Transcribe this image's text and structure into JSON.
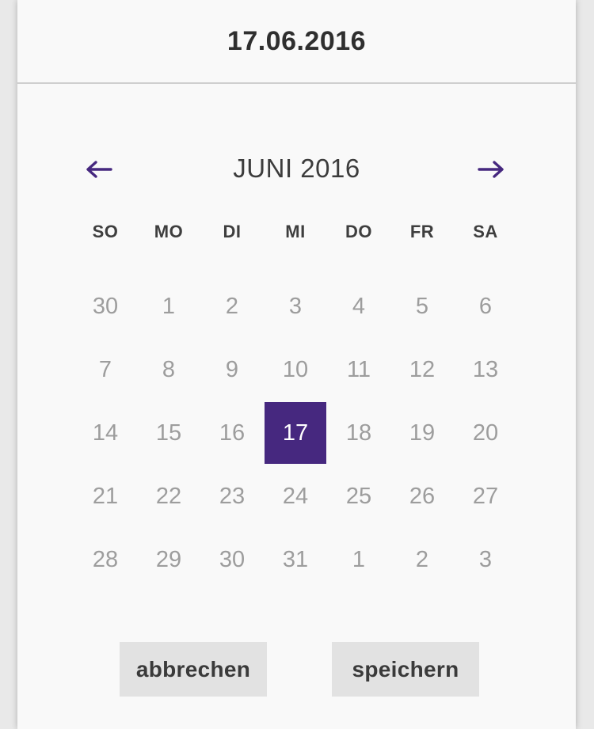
{
  "header": {
    "selected_date": "17.06.2016"
  },
  "calendar": {
    "month_title": "JUNI 2016",
    "prev_icon": "arrow-left-icon",
    "next_icon": "arrow-right-icon",
    "weekdays": [
      "SO",
      "MO",
      "DI",
      "MI",
      "DO",
      "FR",
      "SA"
    ],
    "weeks": [
      [
        "30",
        "1",
        "2",
        "3",
        "4",
        "5",
        "6"
      ],
      [
        "7",
        "8",
        "9",
        "10",
        "11",
        "12",
        "13"
      ],
      [
        "14",
        "15",
        "16",
        "17",
        "18",
        "19",
        "20"
      ],
      [
        "21",
        "22",
        "23",
        "24",
        "25",
        "26",
        "27"
      ],
      [
        "28",
        "29",
        "30",
        "31",
        "1",
        "2",
        "3"
      ]
    ],
    "selected_day": "17",
    "accent_color": "#46287f"
  },
  "actions": {
    "cancel_label": "abbrechen",
    "save_label": "speichern"
  }
}
